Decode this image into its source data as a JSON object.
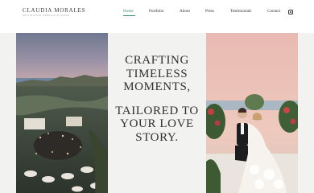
{
  "brand": {
    "name": "CLAUDIA MORALES",
    "tagline": "DESTINATION WEDDING PLANNER"
  },
  "nav": {
    "items": [
      {
        "label": "Home",
        "active": true
      },
      {
        "label": "Portfolio"
      },
      {
        "label": "About"
      },
      {
        "label": "Press"
      },
      {
        "label": "Testimonials"
      },
      {
        "label": "Contact"
      }
    ],
    "social_icon": "instagram-icon"
  },
  "hero": {
    "headline_line1": "CRAFTING TIMELESS MOMENTS,",
    "headline_line2": "TAILORED TO YOUR LOVE STORY.",
    "left_image": "aerial dusk reception overlooking bay",
    "right_image": "couple seated among flowers"
  },
  "colors": {
    "accent": "#3e8c6d",
    "text": "#2f2f2f",
    "background": "#ffffff",
    "hero_bg": "#f2f2f0"
  }
}
